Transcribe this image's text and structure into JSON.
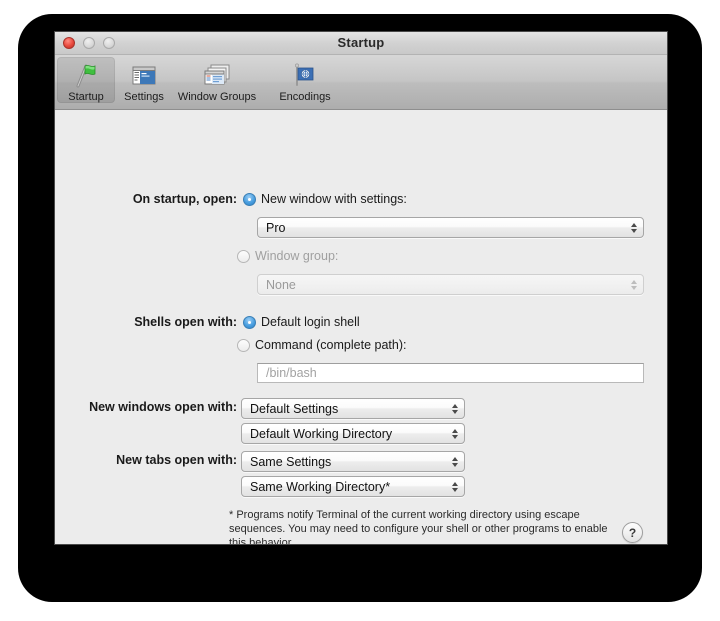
{
  "window": {
    "title": "Startup",
    "traffic_lights": [
      "close-button",
      "minimize-button",
      "zoom-button"
    ]
  },
  "toolbar": {
    "items": [
      {
        "label": "Startup",
        "icon": "green-flag-icon",
        "selected": true
      },
      {
        "label": "Settings",
        "icon": "terminal-window-icon",
        "selected": false
      },
      {
        "label": "Window Groups",
        "icon": "stacked-windows-icon",
        "selected": false
      },
      {
        "label": "Encodings",
        "icon": "un-flag-icon",
        "selected": false
      }
    ]
  },
  "main": {
    "startup": {
      "label": "On startup, open:",
      "option_new_window": {
        "label": "New window with settings:",
        "selected": true
      },
      "settings_popup": {
        "value": "Pro",
        "disabled": false
      },
      "option_window_group": {
        "label": "Window group:",
        "selected": false,
        "disabled": true
      },
      "window_group_popup": {
        "value": "None",
        "disabled": true
      }
    },
    "shells": {
      "label": "Shells open with:",
      "option_default_login_shell": {
        "label": "Default login shell",
        "selected": true
      },
      "option_command": {
        "label": "Command (complete path):",
        "selected": false
      },
      "command_field": {
        "value": "",
        "placeholder": "/bin/bash"
      }
    },
    "new_windows": {
      "label": "New windows open with:",
      "settings_popup": {
        "value": "Default Settings"
      },
      "directory_popup": {
        "value": "Default Working Directory"
      }
    },
    "new_tabs": {
      "label": "New tabs open with:",
      "settings_popup": {
        "value": "Same Settings"
      },
      "directory_popup": {
        "value": "Same Working Directory*"
      }
    },
    "footnote": "* Programs notify Terminal of the current working directory using escape sequences. You may need to configure your shell or other programs to enable this behavior.",
    "help_button": {
      "label": "?"
    }
  },
  "colors": {
    "accent_radio": "#4a9fe0",
    "window_bg": "#ececec",
    "toolbar_bg": "#c5c5c5",
    "backdrop": "#000000"
  }
}
